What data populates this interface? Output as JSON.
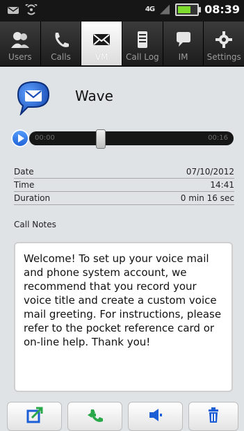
{
  "status_bar": {
    "time": "08:39",
    "network": "4G",
    "icons": [
      "message-icon",
      "wifi-hotspot-icon",
      "signal-icon",
      "battery-icon"
    ]
  },
  "tabs": [
    {
      "label": "Users",
      "icon": "users-icon",
      "active": false
    },
    {
      "label": "Calls",
      "icon": "phone-icon",
      "active": false
    },
    {
      "label": "VM",
      "icon": "envelope-icon",
      "active": true
    },
    {
      "label": "Call Log",
      "icon": "call-log-icon",
      "active": false
    },
    {
      "label": "IM",
      "icon": "chat-icon",
      "active": false
    },
    {
      "label": "Settings",
      "icon": "gear-icon",
      "active": false
    }
  ],
  "message": {
    "title": "Wave"
  },
  "player": {
    "current_time": "00:00",
    "total_time": "00:16"
  },
  "details": [
    {
      "label": "Date",
      "value": "07/10/2012"
    },
    {
      "label": "Time",
      "value": "14:41"
    },
    {
      "label": "Duration",
      "value": "0 min 16 sec"
    }
  ],
  "notes": {
    "label": "Call Notes",
    "text": "Welcome! To set up your voice mail and phone system account, we recommend that you record your voice title and create a custom voice mail greeting. For instructions, please refer to the pocket reference card or on-line help. Thank you!"
  },
  "actions": [
    {
      "icon": "forward-note-icon"
    },
    {
      "icon": "call-back-icon"
    },
    {
      "icon": "speaker-icon"
    },
    {
      "icon": "delete-icon"
    }
  ],
  "colors": {
    "accent_blue": "#1b5ed5",
    "background": "#dfe3e6",
    "top_bar": "#161616",
    "tabs_bar": "#2b2b2b",
    "battery_green": "#7edc2f",
    "call_green": "#29a84a"
  }
}
